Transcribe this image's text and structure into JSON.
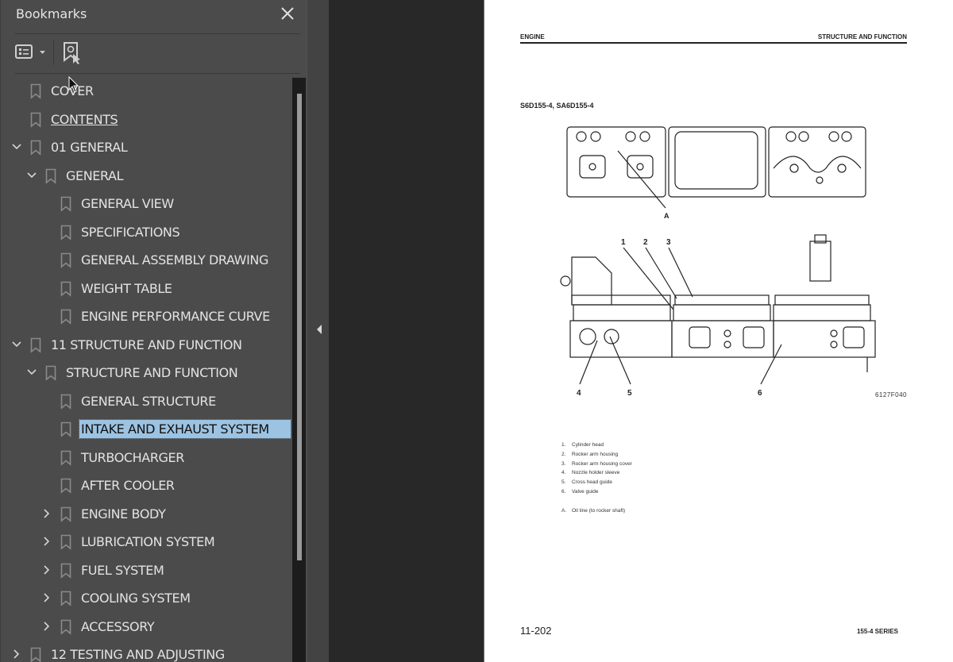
{
  "bookmarks_panel": {
    "title": "Bookmarks",
    "close_icon": "close-icon",
    "toolbar": {
      "options_icon": "list-options-icon",
      "find_bookmark_icon": "find-current-bookmark-icon"
    },
    "items": [
      {
        "label": "COVER",
        "level": 0,
        "expander": "none",
        "link": false,
        "selected": false
      },
      {
        "label": "CONTENTS",
        "level": 0,
        "expander": "none",
        "link": true,
        "selected": false
      },
      {
        "label": "01 GENERAL",
        "level": 0,
        "expander": "expanded",
        "link": false,
        "selected": false
      },
      {
        "label": "GENERAL",
        "level": 1,
        "expander": "expanded",
        "link": false,
        "selected": false
      },
      {
        "label": "GENERAL VIEW",
        "level": 2,
        "expander": "none",
        "link": false,
        "selected": false
      },
      {
        "label": "SPECIFICATIONS",
        "level": 2,
        "expander": "none",
        "link": false,
        "selected": false
      },
      {
        "label": "GENERAL ASSEMBLY DRAWING",
        "level": 2,
        "expander": "none",
        "link": false,
        "selected": false
      },
      {
        "label": "WEIGHT TABLE",
        "level": 2,
        "expander": "none",
        "link": false,
        "selected": false
      },
      {
        "label": "ENGINE PERFORMANCE CURVE",
        "level": 2,
        "expander": "none",
        "link": false,
        "selected": false
      },
      {
        "label": "11 STRUCTURE AND FUNCTION",
        "level": 0,
        "expander": "expanded",
        "link": false,
        "selected": false
      },
      {
        "label": "STRUCTURE AND FUNCTION",
        "level": 1,
        "expander": "expanded",
        "link": false,
        "selected": false
      },
      {
        "label": "GENERAL STRUCTURE",
        "level": 2,
        "expander": "none",
        "link": false,
        "selected": false
      },
      {
        "label": "INTAKE AND EXHAUST SYSTEM",
        "level": 2,
        "expander": "none",
        "link": false,
        "selected": true
      },
      {
        "label": "TURBOCHARGER",
        "level": 2,
        "expander": "none",
        "link": false,
        "selected": false
      },
      {
        "label": "AFTER COOLER",
        "level": 2,
        "expander": "none",
        "link": false,
        "selected": false
      },
      {
        "label": "ENGINE BODY",
        "level": 2,
        "expander": "collapsed",
        "link": false,
        "selected": false
      },
      {
        "label": "LUBRICATION SYSTEM",
        "level": 2,
        "expander": "collapsed",
        "link": false,
        "selected": false
      },
      {
        "label": "FUEL SYSTEM",
        "level": 2,
        "expander": "collapsed",
        "link": false,
        "selected": false
      },
      {
        "label": "COOLING SYSTEM",
        "level": 2,
        "expander": "collapsed",
        "link": false,
        "selected": false
      },
      {
        "label": "ACCESSORY",
        "level": 2,
        "expander": "collapsed",
        "link": false,
        "selected": false
      },
      {
        "label": "12 TESTING AND ADJUSTING",
        "level": 0,
        "expander": "collapsed",
        "link": false,
        "selected": false
      }
    ]
  },
  "collapse_panel_icon": "triangle-left-icon",
  "colors": {
    "panel_bg": "#4b4b4b",
    "viewer_bg": "#282828",
    "selection": "#9dc3e2",
    "page_bg": "#ffffff"
  },
  "document_page": {
    "header_left": "ENGINE",
    "header_right": "STRUCTURE AND FUNCTION",
    "model": "S6D155-4, SA6D155-4",
    "callouts": {
      "top_label": "A",
      "numbers": [
        "1",
        "2",
        "3",
        "4",
        "5",
        "6"
      ]
    },
    "figure_code": "6127F040",
    "legend": [
      {
        "key": "1.",
        "text": "Cylinder head"
      },
      {
        "key": "2.",
        "text": "Rocker arm housing"
      },
      {
        "key": "3.",
        "text": "Rocker arm housing cover"
      },
      {
        "key": "4.",
        "text": "Nozzle holder sleeve"
      },
      {
        "key": "5.",
        "text": "Cross head guide"
      },
      {
        "key": "6.",
        "text": "Valve guide"
      }
    ],
    "legend_extra": {
      "key": "A.",
      "text": "Oil line (to rocker shaft)"
    },
    "page_number": "11-202",
    "series": "155-4 SERIES"
  }
}
